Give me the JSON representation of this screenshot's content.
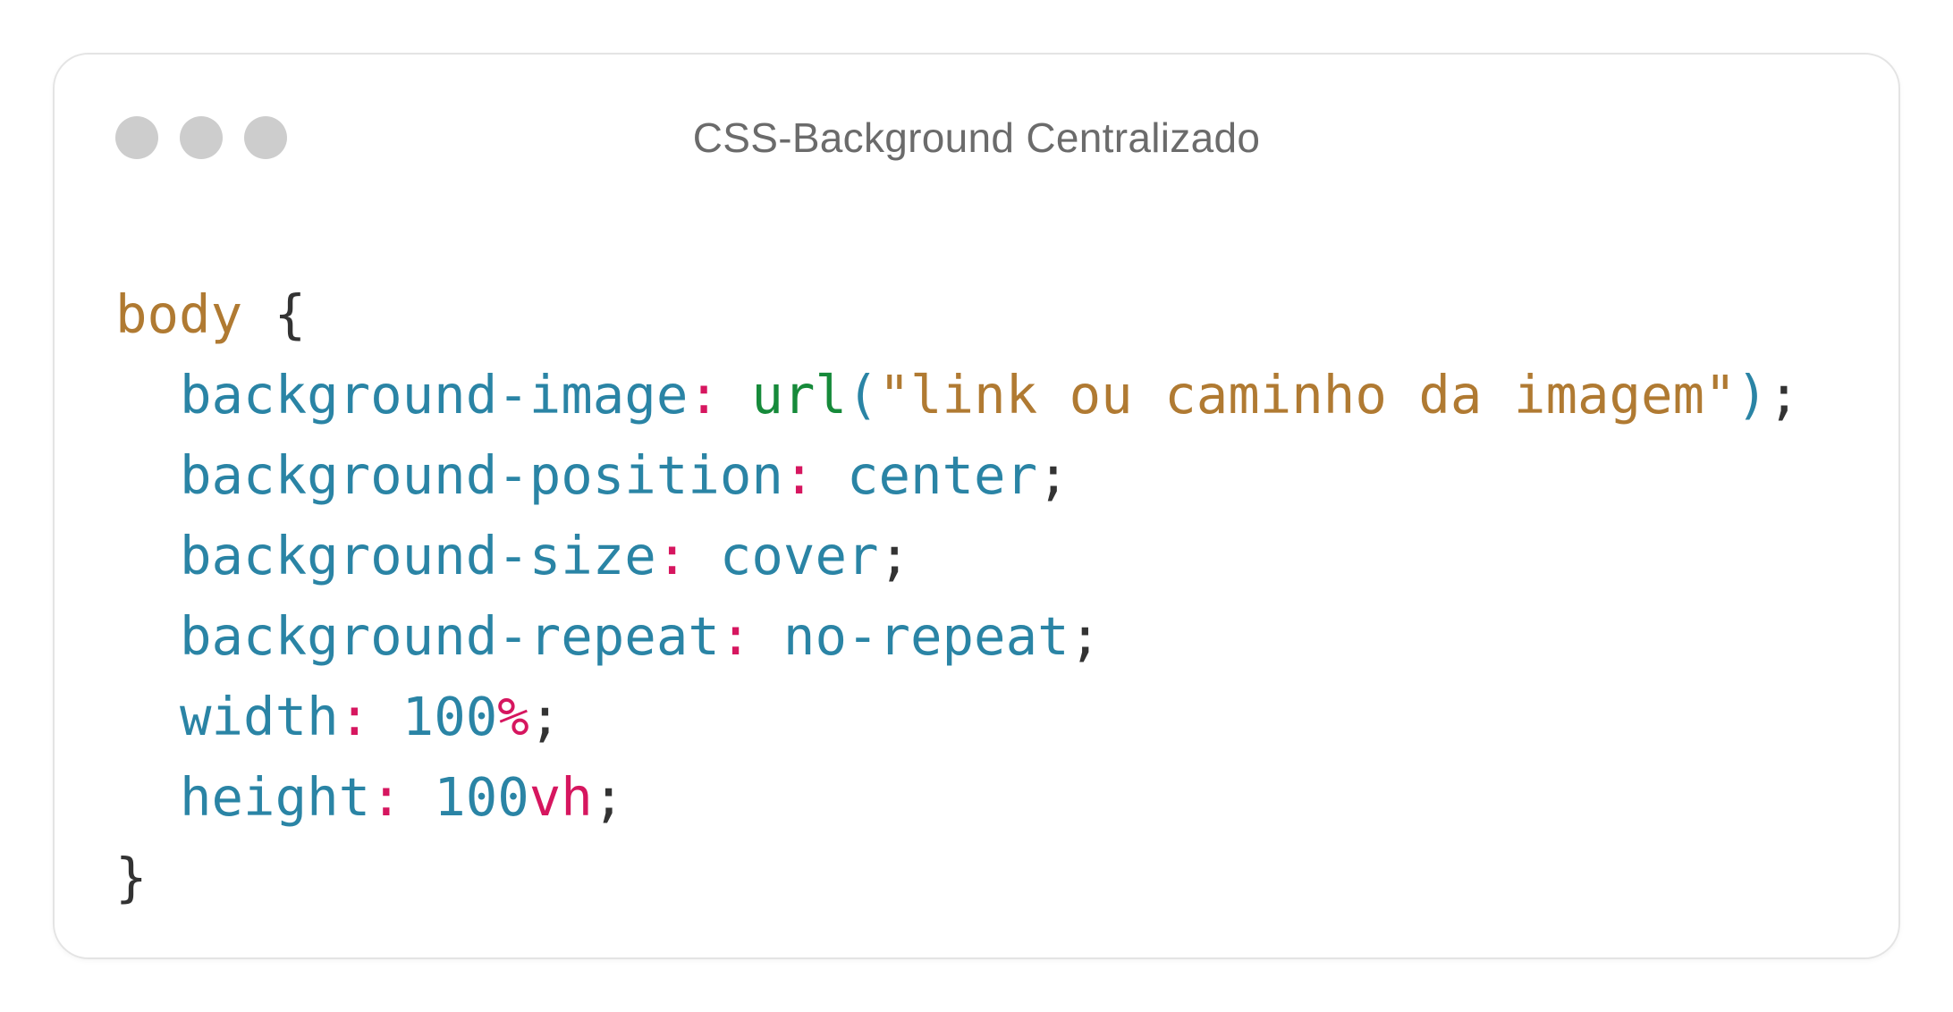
{
  "window": {
    "title": "CSS-Background Centralizado",
    "controls": [
      {
        "name": "close",
        "color": "#cdcdcd"
      },
      {
        "name": "minimize",
        "color": "#cdcdcd"
      },
      {
        "name": "maximize",
        "color": "#cdcdcd"
      }
    ]
  },
  "code": {
    "language": "css",
    "selector": "body",
    "open_brace": "{",
    "close_brace": "}",
    "colon": ":",
    "semicolon": ";",
    "lines": {
      "background_image": {
        "property": "background-image",
        "func": "url",
        "paren_open": "(",
        "string": "\"link ou caminho da imagem\"",
        "paren_close": ")"
      },
      "background_position": {
        "property": "background-position",
        "value": "center"
      },
      "background_size": {
        "property": "background-size",
        "value": "cover"
      },
      "background_repeat": {
        "property": "background-repeat",
        "value": "no-repeat"
      },
      "width": {
        "property": "width",
        "number": "100",
        "unit": "%"
      },
      "height": {
        "property": "height",
        "number": "100",
        "unit": "vh"
      }
    }
  },
  "colors": {
    "selector": "#b07a32",
    "property": "#2a84a5",
    "punctuation_colon": "#d6165f",
    "function": "#168a3a",
    "string": "#b07a32",
    "unit": "#d6165f",
    "plain": "#333333"
  }
}
